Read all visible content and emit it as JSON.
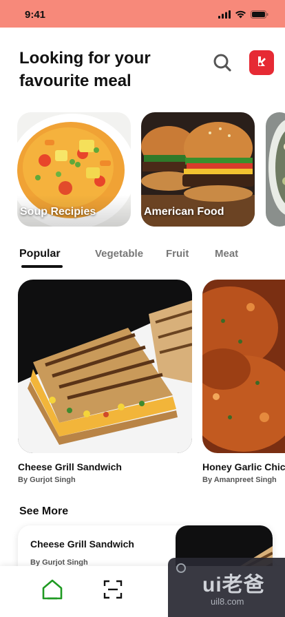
{
  "status_bar": {
    "time": "9:41",
    "icons": [
      "signal-icon",
      "wifi-icon",
      "battery-icon"
    ]
  },
  "header": {
    "title": "Looking for your favourite meal",
    "search_icon": "search-icon",
    "logo_icon": "app-logo-icon"
  },
  "categories": [
    {
      "label": "Soup Recipies",
      "image": "soup-bowl-image"
    },
    {
      "label": "American Food",
      "image": "burger-image"
    },
    {
      "label": "",
      "image": "salad-image"
    }
  ],
  "tabs": [
    {
      "label": "Popular",
      "active": true
    },
    {
      "label": "Vegetable",
      "active": false
    },
    {
      "label": "Fruit",
      "active": false
    },
    {
      "label": "Meat",
      "active": false
    }
  ],
  "recipes": [
    {
      "name": "Cheese Grill Sandwich",
      "author": "By Gurjot Singh",
      "image": "grilled-sandwich-image"
    },
    {
      "name": "Honey Garlic Chicken",
      "author": "By Amanpreet Singh",
      "image": "honey-garlic-chicken-image"
    }
  ],
  "see_more": {
    "label": "See More",
    "items": [
      {
        "name": "Cheese Grill Sandwich",
        "author": "By Gurjot Singh",
        "image": "grilled-sandwich-image"
      }
    ]
  },
  "bottom_nav": [
    {
      "icon": "home-icon",
      "active": true
    },
    {
      "icon": "scan-icon",
      "active": false
    }
  ],
  "watermark": {
    "main": "ui老爸",
    "sub": "uil8.com"
  },
  "colors": {
    "status_bar": "#f7897a",
    "logo_bg": "#e62a34",
    "nav_active": "#1f9a22",
    "text": "#111111",
    "muted": "#777777"
  }
}
